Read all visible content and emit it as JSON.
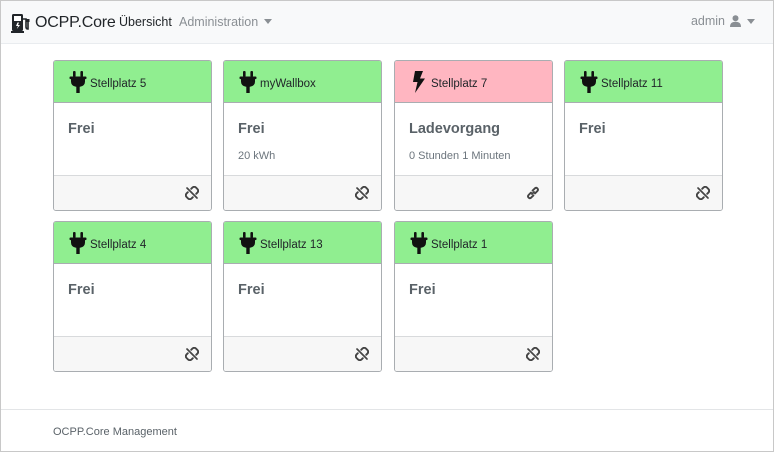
{
  "app": {
    "brand": "OCPP.Core"
  },
  "nav": {
    "items": [
      {
        "label": "Übersicht",
        "active": true
      },
      {
        "label": "Administration",
        "dropdown": true
      }
    ],
    "user": {
      "label": "admin",
      "icon": "user-icon"
    }
  },
  "colors": {
    "free": "#90ee90",
    "charging": "#ffb6c1"
  },
  "chargepoints": [
    {
      "name": "Stellplatz 5",
      "status": "Frei",
      "details": "",
      "state": "free",
      "header_icon": "plug-icon",
      "connection_icon": "link-broken-icon"
    },
    {
      "name": "myWallbox",
      "status": "Frei",
      "details": "20 kWh",
      "state": "free",
      "header_icon": "plug-icon",
      "connection_icon": "link-broken-icon"
    },
    {
      "name": "Stellplatz 7",
      "status": "Ladevorgang",
      "details": "0 Stunden 1 Minuten",
      "state": "charging",
      "header_icon": "bolt-icon",
      "connection_icon": "link-icon"
    },
    {
      "name": "Stellplatz 11",
      "status": "Frei",
      "details": "",
      "state": "free",
      "header_icon": "plug-icon",
      "connection_icon": "link-broken-icon"
    },
    {
      "name": "Stellplatz 4",
      "status": "Frei",
      "details": "",
      "state": "free",
      "header_icon": "plug-icon",
      "connection_icon": "link-broken-icon"
    },
    {
      "name": "Stellplatz 13",
      "status": "Frei",
      "details": "",
      "state": "free",
      "header_icon": "plug-icon",
      "connection_icon": "link-broken-icon"
    },
    {
      "name": "Stellplatz 1",
      "status": "Frei",
      "details": "",
      "state": "free",
      "header_icon": "plug-icon",
      "connection_icon": "link-broken-icon"
    }
  ],
  "footer": {
    "text": "OCPP.Core Management"
  }
}
